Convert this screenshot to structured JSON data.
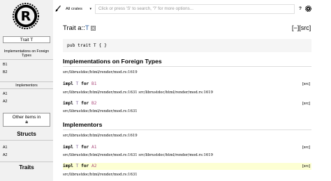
{
  "sidebar": {
    "trait_box_label": "Trait T",
    "impl_foreign_title": "Implementations on Foreign Types",
    "foreign_items": [
      "B1",
      "B2"
    ],
    "implementors_title": "Implementors",
    "implementor_items": [
      "A1",
      "A2"
    ],
    "other_items_line1": "Other items in",
    "other_items_line2": "a",
    "structs_heading": "Structs",
    "struct_items": [
      "A1",
      "A2"
    ],
    "traits_heading": "Traits"
  },
  "toolbar": {
    "crates_select": "All crates",
    "search_placeholder": "Click or press 'S' to search, '?' for more options...",
    "help_label": "?"
  },
  "main": {
    "title_prefix": "Trait a::",
    "title_name": "T",
    "collapse_label": "[−][src]",
    "declaration": "pub trait T { }",
    "foreign_heading": "Implementations on Foreign Types",
    "foreign_path_top": "src/librustdoc/html/render/mod.rs:1619",
    "foreign_impls": [
      {
        "kw_impl": "impl",
        "trait": "T",
        "kw_for": "for",
        "type": "B1",
        "src": "[src]",
        "path": "src/librustdoc/html/render/mod.rs:1631 src/librustdoc/html/render/mod.rs:1619"
      },
      {
        "kw_impl": "impl",
        "trait": "T",
        "kw_for": "for",
        "type": "B2",
        "src": "[src]",
        "path": "src/librustdoc/html/render/mod.rs:1631"
      }
    ],
    "implementors_heading": "Implementors",
    "implementors_path_top": "src/librustdoc/html/render/mod.rs:1619",
    "implementor_impls": [
      {
        "kw_impl": "impl",
        "trait": "T",
        "kw_for": "for",
        "type": "A1",
        "src": "[src]",
        "path": "src/librustdoc/html/render/mod.rs:1631 src/librustdoc/html/render/mod.rs:1619"
      },
      {
        "kw_impl": "impl",
        "trait": "T",
        "kw_for": "for",
        "type": "A2",
        "src": "[src]",
        "path": "src/librustdoc/html/render/mod.rs:1631"
      }
    ]
  },
  "colors": {
    "trait_name": "#2b5c9e",
    "highlight_row": "#fdffd3",
    "sidebar_bg": "#f1f1f1"
  },
  "icons": [
    "rust-logo-icon",
    "paintbrush-icon",
    "chevron-down-icon",
    "gear-icon",
    "toggle-box-icon"
  ]
}
